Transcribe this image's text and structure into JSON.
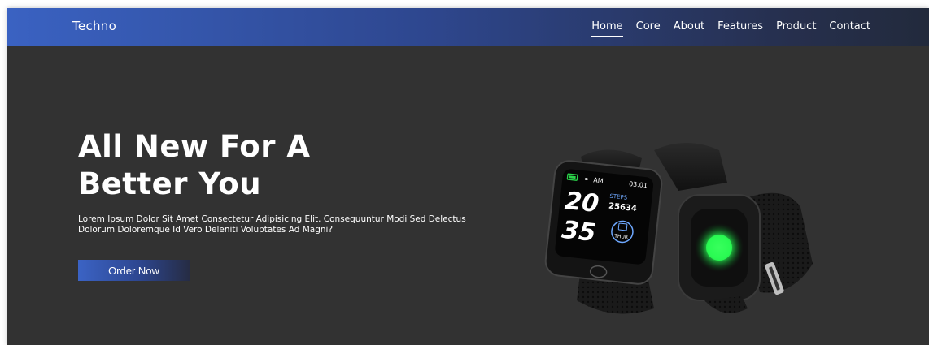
{
  "nav": {
    "brand": "Techno",
    "links": [
      "Home",
      "Core",
      "About",
      "Features",
      "Product",
      "Contact"
    ],
    "active": "Home"
  },
  "hero": {
    "title_line1": "All New For A",
    "title_line2": "Better You",
    "text": "Lorem Ipsum Dolor Sit Amet Consectetur Adipisicing Elit. Consequuntur Modi Sed Delectus Dolorum Doloremque Id Vero Deleniti Voluptates Ad Magni?",
    "button_label": "Order Now"
  },
  "watch": {
    "time_am": "AM",
    "date": "03.01",
    "hour": "20",
    "minute": "35",
    "steps_label": "STEPS",
    "steps": "25634",
    "day": "THUR"
  },
  "colors": {
    "nav_start": "#3a62c2",
    "nav_end": "#222a3c",
    "background": "#323232",
    "sensor_green": "#23e04a"
  }
}
